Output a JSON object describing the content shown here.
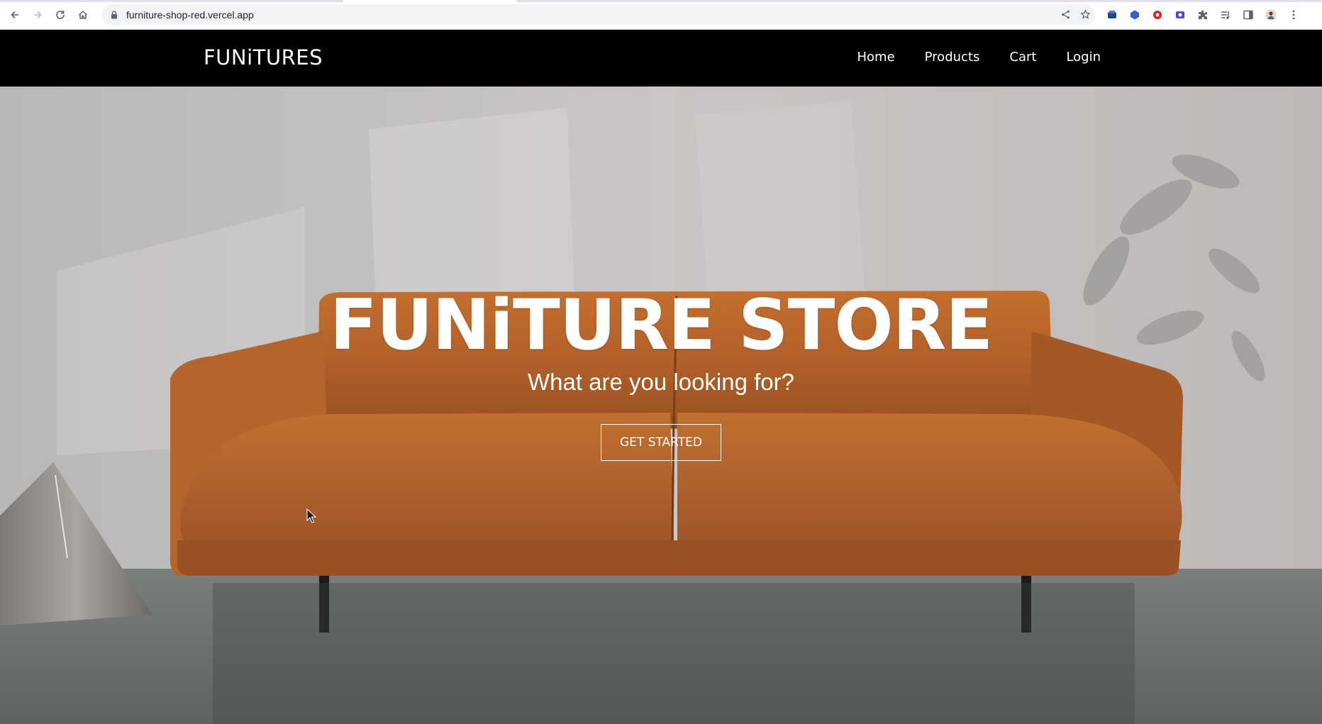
{
  "browser": {
    "url": "furniture-shop-red.vercel.app",
    "icons": [
      "back-icon",
      "forward-icon",
      "reload-icon",
      "home-icon",
      "lock-icon",
      "share-icon",
      "star-icon",
      "extensions-icon",
      "tab-search-icon",
      "side-panel-icon",
      "profile-avatar",
      "menu-icon"
    ]
  },
  "site": {
    "brand": "FUNiTURES",
    "nav": {
      "home": "Home",
      "products": "Products",
      "cart": "Cart",
      "login": "Login"
    },
    "hero": {
      "title": "FUNiTURE STORE",
      "subtitle": "What are you looking for?",
      "cta": "GET STARTED"
    }
  },
  "colors": {
    "navbar_bg": "#000000",
    "sofa": "#b8642a",
    "text_on_hero": "#ffffff"
  }
}
